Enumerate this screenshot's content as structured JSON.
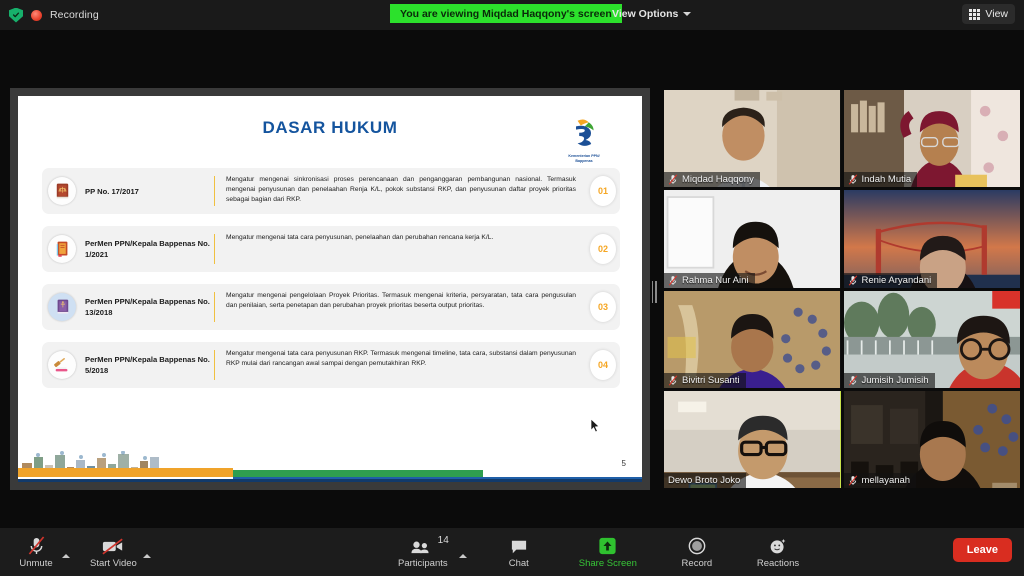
{
  "topbar": {
    "encryption_icon": "shield-check-icon",
    "recording_icon": "record-dot-icon",
    "recording_label": "Recording",
    "share_banner": "You are viewing Miqdad Haqqony's screen",
    "view_options_label": "View Options",
    "view_options_icon": "chevron-down-icon",
    "view_label": "View",
    "view_icon": "grid-icon",
    "banner_color": "#2ce12c"
  },
  "slide": {
    "title": "DASAR HUKUM",
    "title_color": "#14549e",
    "logo_caption": "Kementerian PPN/\nBappenas",
    "page_number": "5",
    "rows": [
      {
        "icon": "law-book-scales-icon",
        "name": "PP No. 17/2017",
        "desc": "Mengatur mengenai sinkronisasi proses perencanaan dan penganggaran pembangunan nasional. Termasuk mengenai penyusunan dan penelaahan Renja K/L, pokok substansi RKP, dan penyusunan daftar proyek prioritas sebagai bagian dari RKP.",
        "number": "01"
      },
      {
        "icon": "orange-book-icon",
        "name": "PerMen PPN/Kepala Bappenas No. 1/2021",
        "desc": "Mengatur mengenai tata cara penyusunan, penelaahan dan perubahan rencana kerja K/L.",
        "number": "02"
      },
      {
        "icon": "purple-book-scales-icon",
        "name": "PerMen PPN/Kepala Bappenas No. 13/2018",
        "desc": "Mengatur mengenai pengelolaan Proyek Prioritas. Termasuk mengenai kriteria, persyaratan, tata cara pengusulan dan penilaian, serta penetapan dan perubahan proyek prioritas beserta output prioritas.",
        "number": "03"
      },
      {
        "icon": "gavel-icon",
        "name": "PerMen PPN/Kepala Bappenas No. 5/2018",
        "desc": "Mengatur mengenai tata cara penyusunan RKP. Termasuk mengenai timeline, tata cara, substansi dalam penyusunan RKP mulai dari rancangan awal sampai dengan pemutakhiran RKP.",
        "number": "04"
      }
    ]
  },
  "participants": [
    {
      "name": "Miqdad Haqqony",
      "muted": true,
      "speaking": false
    },
    {
      "name": "Indah Mutia",
      "muted": true,
      "speaking": false
    },
    {
      "name": "Rahma Nur Aini",
      "muted": true,
      "speaking": false
    },
    {
      "name": "Renie Aryandani",
      "muted": true,
      "speaking": false
    },
    {
      "name": "Bivitri Susanti",
      "muted": true,
      "speaking": false
    },
    {
      "name": "Jumisih Jumisih",
      "muted": true,
      "speaking": false
    },
    {
      "name": "Dewo Broto Joko",
      "muted": false,
      "speaking": true
    },
    {
      "name": "mellayanah",
      "muted": true,
      "speaking": false
    }
  ],
  "toolbar": {
    "mic_label": "Unmute",
    "mic_icon": "microphone-muted-icon",
    "video_label": "Start Video",
    "video_icon": "video-off-icon",
    "participants_label": "Participants",
    "participants_icon": "people-icon",
    "participants_count": "14",
    "chat_label": "Chat",
    "chat_icon": "chat-bubble-icon",
    "share_label": "Share Screen",
    "share_icon": "share-screen-icon",
    "record_label": "Record",
    "record_icon": "record-circle-icon",
    "reactions_label": "Reactions",
    "reactions_icon": "smiley-reactions-icon",
    "leave_label": "Leave",
    "leave_color": "#d92d20",
    "share_color": "#37c537"
  }
}
